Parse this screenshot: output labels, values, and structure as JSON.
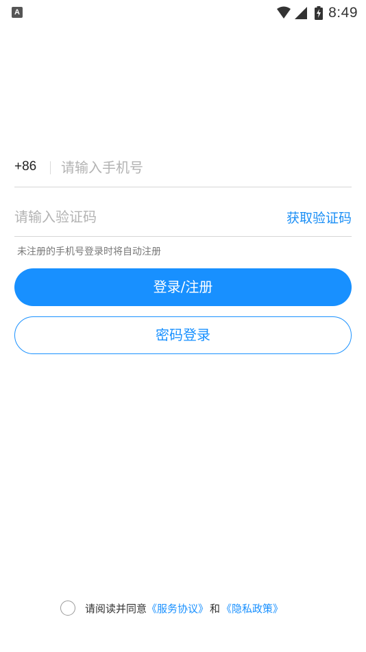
{
  "status_bar": {
    "notification_icon": "A",
    "time": "8:49",
    "icons": [
      "wifi-icon",
      "signal-icon",
      "battery-charging-icon"
    ]
  },
  "login": {
    "country_code": "+86",
    "phone_placeholder": "请输入手机号",
    "code_placeholder": "请输入验证码",
    "get_code_label": "获取验证码",
    "hint": "未注册的手机号登录时将自动注册",
    "primary_button": "登录/注册",
    "secondary_button": "密码登录"
  },
  "agreement": {
    "prefix": "请阅读并同意",
    "service_link": "《服务协议》",
    "conjunction": "和",
    "privacy_link": "《隐私政策》",
    "checked": false
  },
  "colors": {
    "accent": "#1890ff",
    "link": "#1a8ef5",
    "placeholder": "#b3b3b3"
  }
}
